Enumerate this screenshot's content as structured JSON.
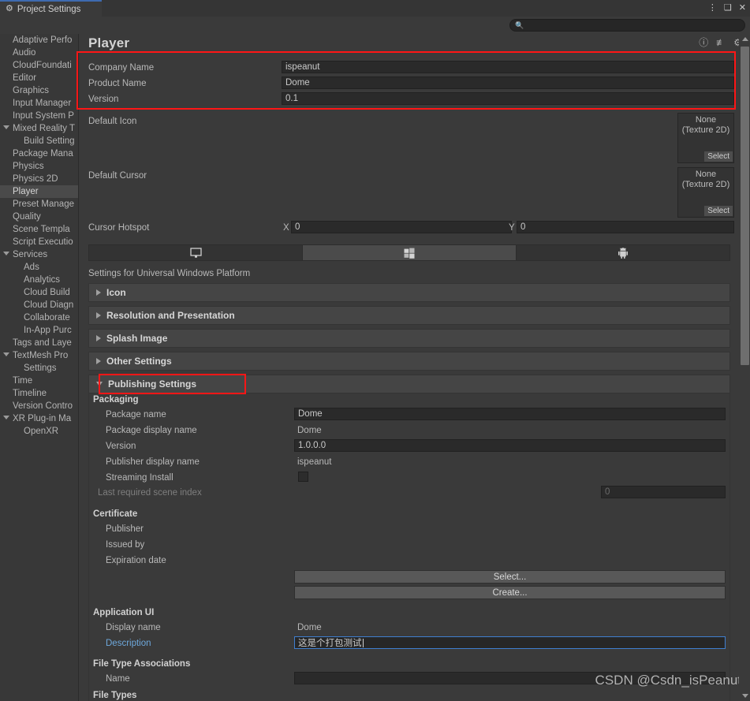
{
  "window": {
    "tab_label": "Project Settings",
    "tab_icon": "gear-icon",
    "controls": {
      "menu": "⋮",
      "maximize": "❑",
      "close": "✕"
    }
  },
  "search": {
    "placeholder": "",
    "value": "",
    "icon": "search-icon"
  },
  "sidebar": {
    "items": [
      {
        "label": "Adaptive Perfo",
        "indent": 0,
        "foldout": "",
        "selected": false
      },
      {
        "label": "Audio",
        "indent": 0,
        "foldout": "",
        "selected": false
      },
      {
        "label": "CloudFoundati",
        "indent": 0,
        "foldout": "",
        "selected": false
      },
      {
        "label": "Editor",
        "indent": 0,
        "foldout": "",
        "selected": false
      },
      {
        "label": "Graphics",
        "indent": 0,
        "foldout": "",
        "selected": false
      },
      {
        "label": "Input Manager",
        "indent": 0,
        "foldout": "",
        "selected": false
      },
      {
        "label": "Input System P",
        "indent": 0,
        "foldout": "",
        "selected": false
      },
      {
        "label": "Mixed Reality T",
        "indent": 0,
        "foldout": "down",
        "selected": false
      },
      {
        "label": "Build Setting",
        "indent": 1,
        "foldout": "",
        "selected": false
      },
      {
        "label": "Package Mana",
        "indent": 0,
        "foldout": "",
        "selected": false
      },
      {
        "label": "Physics",
        "indent": 0,
        "foldout": "",
        "selected": false
      },
      {
        "label": "Physics 2D",
        "indent": 0,
        "foldout": "",
        "selected": false
      },
      {
        "label": "Player",
        "indent": 0,
        "foldout": "",
        "selected": true
      },
      {
        "label": "Preset Manage",
        "indent": 0,
        "foldout": "",
        "selected": false
      },
      {
        "label": "Quality",
        "indent": 0,
        "foldout": "",
        "selected": false
      },
      {
        "label": "Scene Templa",
        "indent": 0,
        "foldout": "",
        "selected": false
      },
      {
        "label": "Script Executio",
        "indent": 0,
        "foldout": "",
        "selected": false
      },
      {
        "label": "Services",
        "indent": 0,
        "foldout": "down",
        "selected": false
      },
      {
        "label": "Ads",
        "indent": 1,
        "foldout": "",
        "selected": false
      },
      {
        "label": "Analytics",
        "indent": 1,
        "foldout": "",
        "selected": false
      },
      {
        "label": "Cloud Build",
        "indent": 1,
        "foldout": "",
        "selected": false
      },
      {
        "label": "Cloud Diagn",
        "indent": 1,
        "foldout": "",
        "selected": false
      },
      {
        "label": "Collaborate",
        "indent": 1,
        "foldout": "",
        "selected": false
      },
      {
        "label": "In-App Purc",
        "indent": 1,
        "foldout": "",
        "selected": false
      },
      {
        "label": "Tags and Laye",
        "indent": 0,
        "foldout": "",
        "selected": false
      },
      {
        "label": "TextMesh Pro",
        "indent": 0,
        "foldout": "down",
        "selected": false
      },
      {
        "label": "Settings",
        "indent": 1,
        "foldout": "",
        "selected": false
      },
      {
        "label": "Time",
        "indent": 0,
        "foldout": "",
        "selected": false
      },
      {
        "label": "Timeline",
        "indent": 0,
        "foldout": "",
        "selected": false
      },
      {
        "label": "Version Contro",
        "indent": 0,
        "foldout": "",
        "selected": false
      },
      {
        "label": "XR Plug-in Ma",
        "indent": 0,
        "foldout": "down",
        "selected": false
      },
      {
        "label": "OpenXR",
        "indent": 1,
        "foldout": "",
        "selected": false
      }
    ]
  },
  "header": {
    "title": "Player",
    "icons": [
      "help-icon",
      "preset-icon",
      "gear-icon"
    ]
  },
  "identification": {
    "company_name_label": "Company Name",
    "company_name_value": "ispeanut",
    "product_name_label": "Product Name",
    "product_name_value": "Dome",
    "version_label": "Version",
    "version_value": "0.1"
  },
  "icons_section": {
    "default_icon_label": "Default Icon",
    "default_icon_none": "None",
    "default_icon_type": "(Texture 2D)",
    "default_icon_select": "Select",
    "default_cursor_label": "Default Cursor",
    "default_cursor_none": "None",
    "default_cursor_type": "(Texture 2D)",
    "default_cursor_select": "Select",
    "cursor_hotspot_label": "Cursor Hotspot",
    "hotspot_x_label": "X",
    "hotspot_x_value": "0",
    "hotspot_y_label": "Y",
    "hotspot_y_value": "0"
  },
  "platform_tabs": [
    {
      "icon": "desktop-icon",
      "active": false
    },
    {
      "icon": "windows-icon",
      "active": true
    },
    {
      "icon": "android-icon",
      "active": false
    }
  ],
  "settings_for": "Settings for Universal Windows Platform",
  "foldouts": [
    {
      "label": "Icon",
      "expanded": false
    },
    {
      "label": "Resolution and Presentation",
      "expanded": false
    },
    {
      "label": "Splash Image",
      "expanded": false
    },
    {
      "label": "Other Settings",
      "expanded": false
    },
    {
      "label": "Publishing Settings",
      "expanded": true
    }
  ],
  "publishing": {
    "packaging_header": "Packaging",
    "package_name_label": "Package name",
    "package_name_value": "Dome",
    "package_display_name_label": "Package display name",
    "package_display_name_value": "Dome",
    "version_label": "Version",
    "version_value": "1.0.0.0",
    "publisher_display_name_label": "Publisher display name",
    "publisher_display_name_value": "ispeanut",
    "streaming_install_label": "Streaming Install",
    "streaming_install_checked": false,
    "last_required_scene_index_label": "Last required scene index",
    "last_required_scene_index_value": "0",
    "certificate_header": "Certificate",
    "publisher_label": "Publisher",
    "publisher_value": "",
    "issued_by_label": "Issued by",
    "issued_by_value": "",
    "expiration_date_label": "Expiration date",
    "expiration_date_value": "",
    "select_button": "Select...",
    "create_button": "Create...",
    "application_ui_header": "Application UI",
    "display_name_label": "Display name",
    "display_name_value": "Dome",
    "description_label": "Description",
    "description_value": "这是个打包测试",
    "file_type_assoc_header": "File Type Associations",
    "name_label": "Name",
    "name_value": "",
    "file_types_header": "File Types"
  },
  "watermark": "CSDN @Csdn_isPeanut",
  "colors": {
    "accent_red": "#fe1616",
    "panel_bg": "#3a3a3a",
    "sidebar_bg": "#383838",
    "field_bg": "#2a2a2a",
    "focus_blue": "#3f7fd0",
    "link_blue": "#6ea8dc"
  }
}
